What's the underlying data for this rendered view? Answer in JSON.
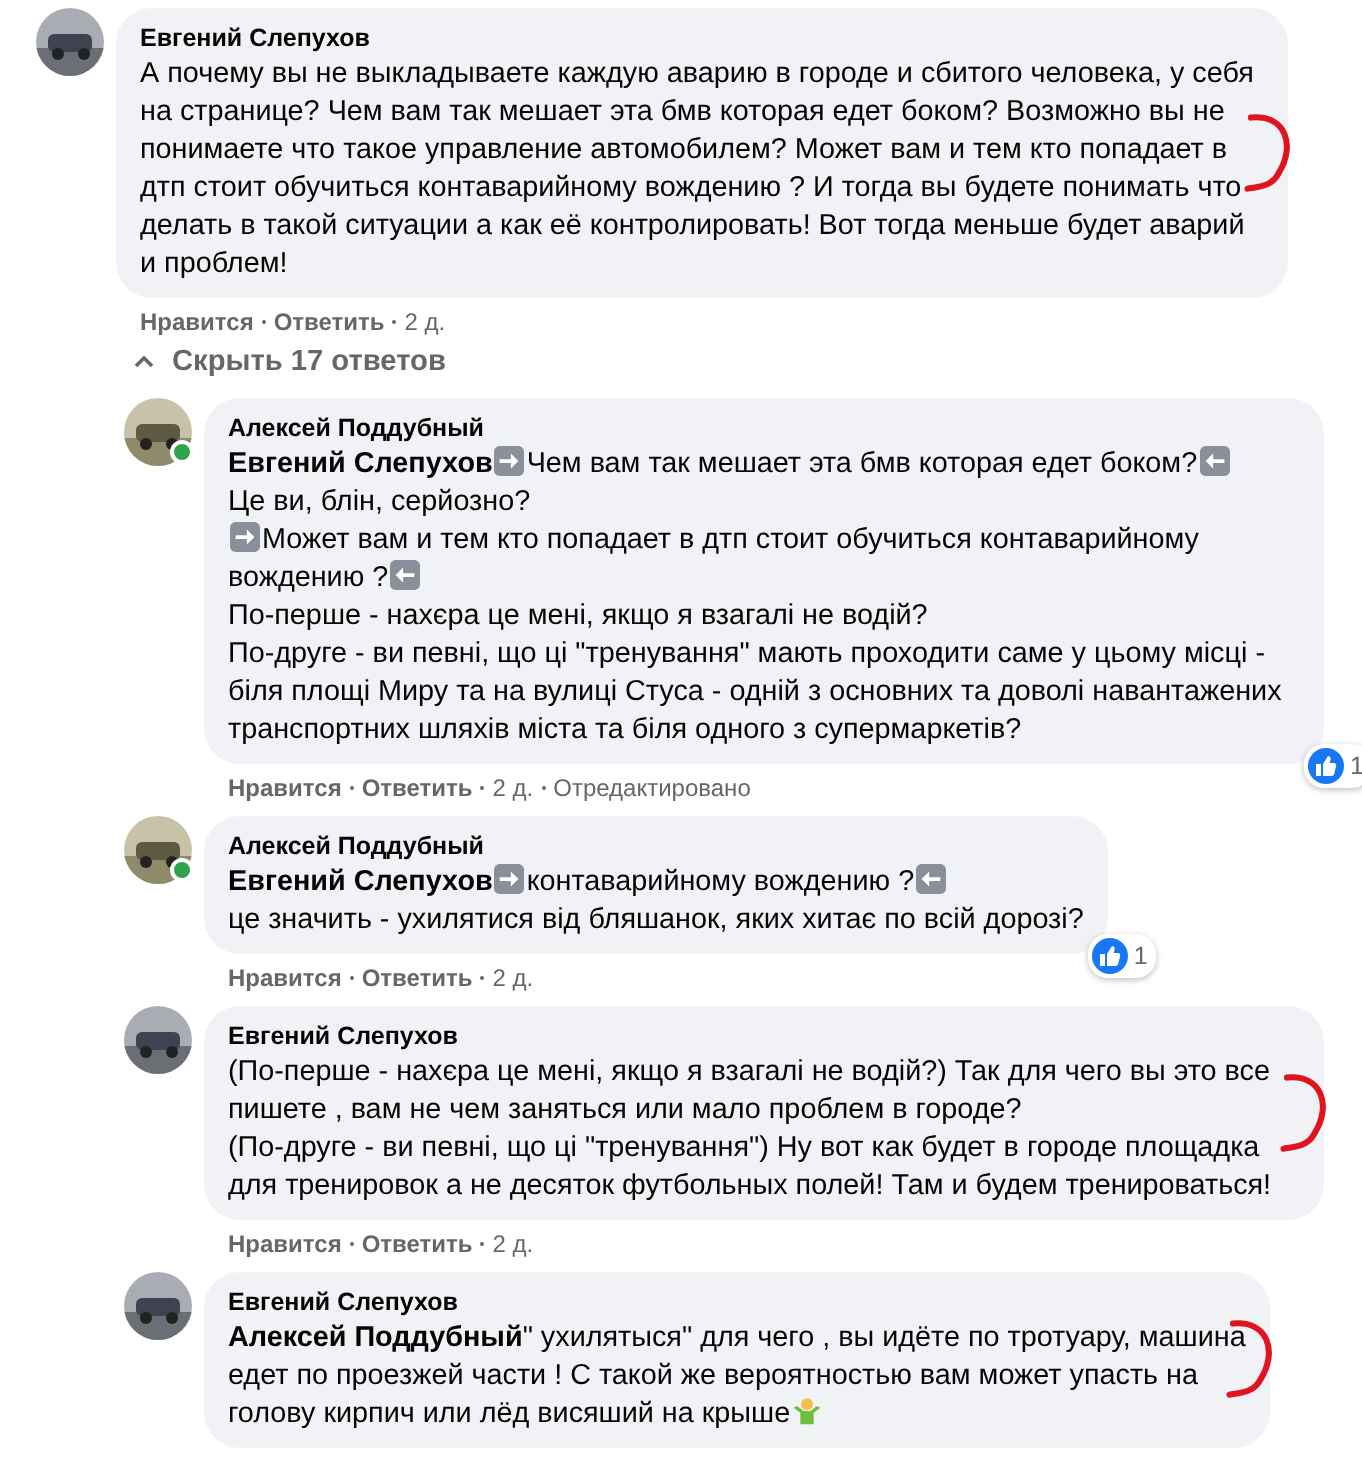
{
  "comments": [
    {
      "author": "Евгений Слепухов",
      "online": false,
      "marked": true,
      "body": [
        {
          "kind": "text",
          "text": "А почему вы не выкладываете каждую аварию в городе и сбитого человека, у себя на странице? Чем вам так мешает эта бмв которая едет боком? Возможно вы не понимаете что такое управление автомобилем? Может вам и тем кто попадает в дтп стоит обучиться контаварийному вождению ? И тогда вы будете понимать что делать в такой ситуации а как её контролировать! Вот тогда меньше будет аварий и проблем!"
        }
      ],
      "actions": {
        "like": "Нравится",
        "reply": "Ответить",
        "time": "2 д."
      },
      "toggle": {
        "label": "Скрыть 17 ответов",
        "expanded": true
      },
      "replies": [
        {
          "author": "Алексей Поддубный",
          "online": true,
          "marked": false,
          "body": [
            {
              "kind": "mention",
              "text": "Евгений Слепухов"
            },
            {
              "kind": "right-arrow"
            },
            {
              "kind": "text",
              "text": "Чем вам так мешает эта бмв которая едет боком?"
            },
            {
              "kind": "left-arrow"
            },
            {
              "kind": "break"
            },
            {
              "kind": "text",
              "text": "Це ви, блін, серйозно?"
            },
            {
              "kind": "break"
            },
            {
              "kind": "right-arrow"
            },
            {
              "kind": "text",
              "text": "Может вам и тем кто попадает в дтп стоит обучиться контаварийному"
            },
            {
              "kind": "break"
            },
            {
              "kind": "text",
              "text": "вождению ?"
            },
            {
              "kind": "left-arrow"
            },
            {
              "kind": "break"
            },
            {
              "kind": "text",
              "text": "По-перше - нахєра це мені, якщо я взагалі не водій?"
            },
            {
              "kind": "break"
            },
            {
              "kind": "text",
              "text": "По-друге - ви певні, що ці \"тренування\" мають проходити саме у цьому місці - біля площі Миру та на вулиці Стуса - одній з основних та доволі навантажених транспортних шляхів міста та біля одного з супермаркетів?"
            }
          ],
          "reactions": "1",
          "actions": {
            "like": "Нравится",
            "reply": "Ответить",
            "time": "2 д.",
            "edited": "Отредактировано"
          }
        },
        {
          "author": "Алексей Поддубный",
          "online": true,
          "marked": false,
          "body": [
            {
              "kind": "mention",
              "text": "Евгений Слепухов"
            },
            {
              "kind": "right-arrow"
            },
            {
              "kind": "text",
              "text": "контаварийному вождению ?"
            },
            {
              "kind": "left-arrow"
            },
            {
              "kind": "break"
            },
            {
              "kind": "text",
              "text": "це значить - ухилятися від бляшанок, яких хитає по всій дорозі?"
            }
          ],
          "reactions": "1",
          "actions": {
            "like": "Нравится",
            "reply": "Ответить",
            "time": "2 д."
          }
        },
        {
          "author": "Евгений Слепухов",
          "online": false,
          "marked": true,
          "body": [
            {
              "kind": "text",
              "text": "(По-перше - нахєра це мені, якщо я взагалі не водій?) Так для чего вы это все пишете , вам не чем заняться или мало проблем в городе?"
            },
            {
              "kind": "break"
            },
            {
              "kind": "text",
              "text": "(По-друге - ви певні, що ці \"тренування\") Ну вот как будет в городе площадка для тренировок а не десяток футбольных полей! Там и будем тренироваться!"
            }
          ],
          "actions": {
            "like": "Нравится",
            "reply": "Ответить",
            "time": "2 д."
          }
        },
        {
          "author": "Евгений Слепухов",
          "online": false,
          "marked": true,
          "body": [
            {
              "kind": "mention",
              "text": "Алексей Поддубный"
            },
            {
              "kind": "text",
              "text": "\" ухилятыся\" для чего , вы идёте по тротуару, машина"
            },
            {
              "kind": "break"
            },
            {
              "kind": "text",
              "text": "едет по проезжей части ! С такой же вероятностью вам может упасть на"
            },
            {
              "kind": "break"
            },
            {
              "kind": "text",
              "text": "голову кирпич или лёд висяший на крыше"
            },
            {
              "kind": "emoji"
            }
          ]
        }
      ]
    }
  ]
}
